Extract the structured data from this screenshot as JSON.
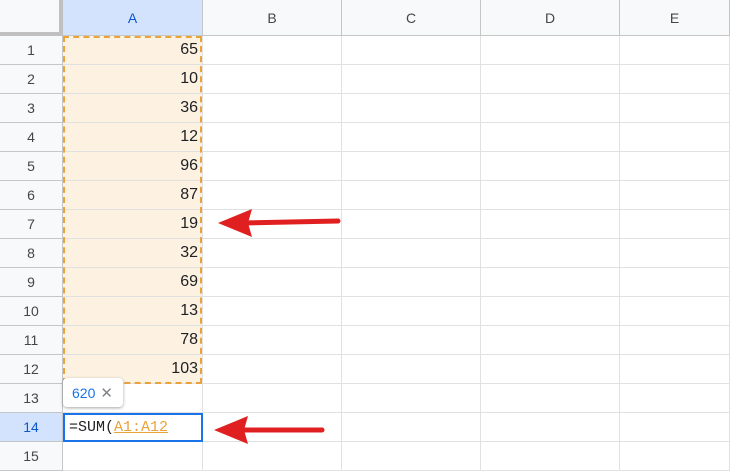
{
  "sheet": {
    "columns": [
      "A",
      "B",
      "C",
      "D",
      "E"
    ],
    "rows": [
      "1",
      "2",
      "3",
      "4",
      "5",
      "6",
      "7",
      "8",
      "9",
      "10",
      "11",
      "12",
      "13",
      "14",
      "15"
    ],
    "column_a_values": [
      "65",
      "10",
      "36",
      "12",
      "96",
      "87",
      "19",
      "32",
      "69",
      "13",
      "78",
      "103"
    ]
  },
  "formula": {
    "prefix": "=SUM(",
    "range_arg": "A1:A12"
  },
  "tooltip": {
    "value": "620",
    "close_glyph": "✕"
  },
  "colors": {
    "reference_fill": "#fdf2e2",
    "reference_border": "#e8a33b",
    "edit_border": "#1a73e8",
    "annotation_arrow": "#e02020"
  },
  "icons": {
    "annotation_arrow": "red-arrow-left-icon",
    "tooltip_close": "close-icon"
  }
}
